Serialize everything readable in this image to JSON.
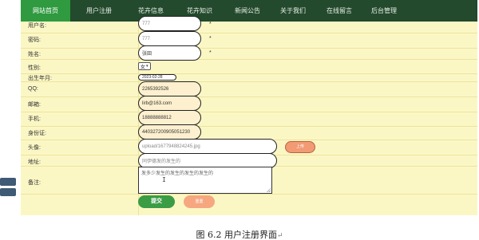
{
  "nav": {
    "items": [
      {
        "label": "网站首页",
        "active": true
      },
      {
        "label": "用户注册",
        "active": false
      },
      {
        "label": "花卉信息",
        "active": false
      },
      {
        "label": "花卉知识",
        "active": false
      },
      {
        "label": "新闻公告",
        "active": false
      },
      {
        "label": "关于我们",
        "active": false
      },
      {
        "label": "在线留言",
        "active": false
      },
      {
        "label": "后台管理",
        "active": false
      }
    ]
  },
  "form": {
    "username": {
      "label": "用户名:",
      "value": "777",
      "required": "*"
    },
    "password": {
      "label": "密码:",
      "value": "777",
      "required": "*"
    },
    "name": {
      "label": "姓名:",
      "value": "张田",
      "required": "*"
    },
    "gender": {
      "label": "性别:",
      "value": "女"
    },
    "birthdate": {
      "label": "出生年月:",
      "value": "2023-02-28"
    },
    "qq": {
      "label": "QQ:",
      "value": "2265392526"
    },
    "email": {
      "label": "邮箱:",
      "value": "lirb@163.com"
    },
    "phone": {
      "label": "手机:",
      "value": "18888888812"
    },
    "idcard": {
      "label": "身份证:",
      "value": "440327200905051230"
    },
    "avatar": {
      "label": "头像:",
      "value": "upload/1677948824245.jpg",
      "upload_label": "上传"
    },
    "address": {
      "label": "地址:",
      "value": "同伊德发的发生的"
    },
    "remark": {
      "label": "备注:",
      "value": "发多少发生的发生的发生的发生的"
    },
    "submit_label": "提交",
    "reset_label": "重置"
  },
  "caption": {
    "text": "图 6.2 用户注册界面",
    "mark": "↵"
  },
  "colors": {
    "nav_bg": "#234a2c",
    "nav_active": "#2f9a3f",
    "panel_bg": "#fbf7c5",
    "submit": "#3a9c45",
    "reset": "#f6a77f"
  }
}
